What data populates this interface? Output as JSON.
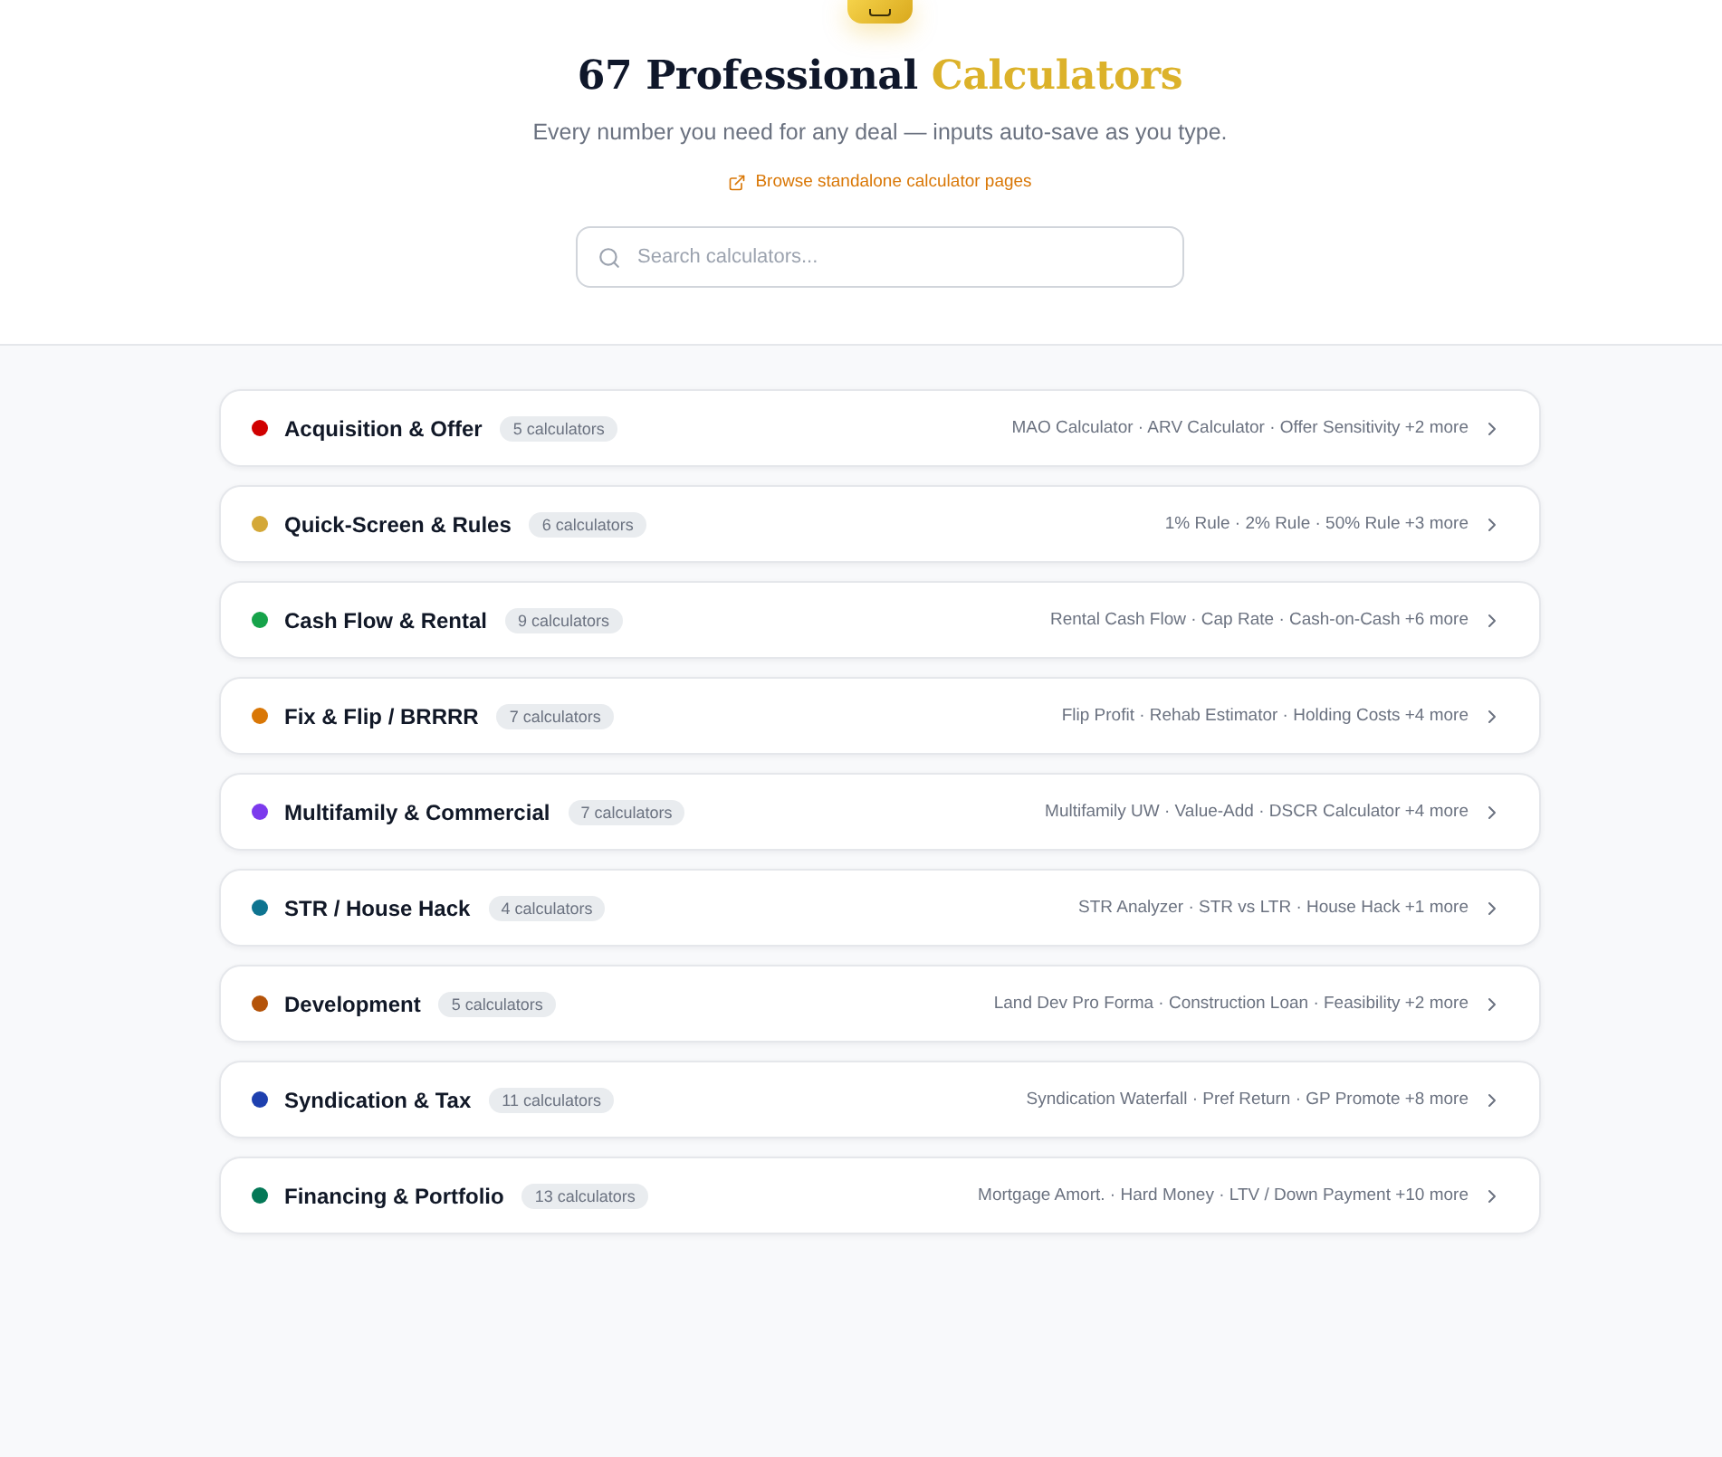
{
  "header": {
    "title": "67 Professional",
    "title_accent": "Calculators",
    "subtitle": "Every number you need for any deal — inputs auto-save as you type.",
    "link": "Browse standalone calculator pages",
    "search": {
      "placeholder": "Search calculators..."
    }
  },
  "categories": [
    {
      "name": "Acquisition & Offer",
      "color": "#d00000",
      "count": "5 calculators",
      "summary": "MAO Calculator · ARV Calculator · Offer Sensitivity +2 more"
    },
    {
      "name": "Quick-Screen & Rules",
      "color": "#d4a838",
      "count": "6 calculators",
      "summary": "1% Rule · 2% Rule · 50% Rule +3 more"
    },
    {
      "name": "Cash Flow & Rental",
      "color": "#16a34a",
      "count": "9 calculators",
      "summary": "Rental Cash Flow · Cap Rate · Cash-on-Cash +6 more"
    },
    {
      "name": "Fix & Flip / BRRRR",
      "color": "#d97706",
      "count": "7 calculators",
      "summary": "Flip Profit · Rehab Estimator · Holding Costs +4 more"
    },
    {
      "name": "Multifamily & Commercial",
      "color": "#7c3aed",
      "count": "7 calculators",
      "summary": "Multifamily UW · Value-Add · DSCR Calculator +4 more"
    },
    {
      "name": "STR / House Hack",
      "color": "#0e7490",
      "count": "4 calculators",
      "summary": "STR Analyzer · STR vs LTR · House Hack +1 more"
    },
    {
      "name": "Development",
      "color": "#b45309",
      "count": "5 calculators",
      "summary": "Land Dev Pro Forma · Construction Loan · Feasibility +2 more"
    },
    {
      "name": "Syndication & Tax",
      "color": "#1e40af",
      "count": "11 calculators",
      "summary": "Syndication Waterfall · Pref Return · GP Promote +8 more"
    },
    {
      "name": "Financing & Portfolio",
      "color": "#047857",
      "count": "13 calculators",
      "summary": "Mortgage Amort. · Hard Money · LTV / Down Payment +10 more"
    }
  ]
}
